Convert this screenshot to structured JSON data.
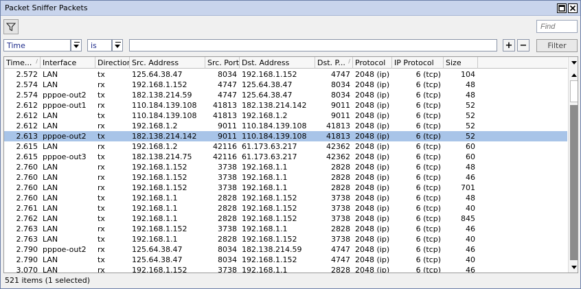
{
  "window": {
    "title": "Packet Sniffer Packets"
  },
  "toolbar": {
    "filter_icon": "funnel-icon",
    "find_placeholder": "Find"
  },
  "filterbar": {
    "field_value": "Time",
    "operator_value": "is",
    "value_text": "",
    "add_label": "+",
    "remove_label": "−",
    "apply_label": "Filter"
  },
  "grid": {
    "columns": [
      {
        "label": "Time...",
        "sort": "/"
      },
      {
        "label": "Interface",
        "sort": ""
      },
      {
        "label": "Direction",
        "sort": ""
      },
      {
        "label": "Src. Address",
        "sort": ""
      },
      {
        "label": "Src. Port",
        "sort": ""
      },
      {
        "label": "Dst. Address",
        "sort": ""
      },
      {
        "label": "Dst. P...",
        "sort": "/"
      },
      {
        "label": "Protocol",
        "sort": ""
      },
      {
        "label": "IP Protocol",
        "sort": ""
      },
      {
        "label": "Size",
        "sort": ""
      }
    ],
    "rows": [
      [
        "2.572",
        "LAN",
        "tx",
        "125.64.38.47",
        "8034",
        "192.168.1.152",
        "4747",
        "2048 (ip)",
        "6 (tcp)",
        "104"
      ],
      [
        "2.574",
        "LAN",
        "rx",
        "192.168.1.152",
        "4747",
        "125.64.38.47",
        "8034",
        "2048 (ip)",
        "6 (tcp)",
        "48"
      ],
      [
        "2.574",
        "pppoe-out2",
        "tx",
        "182.138.214.59",
        "4747",
        "125.64.38.47",
        "8034",
        "2048 (ip)",
        "6 (tcp)",
        "48"
      ],
      [
        "2.612",
        "pppoe-out1",
        "rx",
        "110.184.139.108",
        "41813",
        "182.138.214.142",
        "9011",
        "2048 (ip)",
        "6 (tcp)",
        "52"
      ],
      [
        "2.612",
        "LAN",
        "tx",
        "110.184.139.108",
        "41813",
        "192.168.1.2",
        "9011",
        "2048 (ip)",
        "6 (tcp)",
        "52"
      ],
      [
        "2.612",
        "LAN",
        "rx",
        "192.168.1.2",
        "9011",
        "110.184.139.108",
        "41813",
        "2048 (ip)",
        "6 (tcp)",
        "52"
      ],
      [
        "2.613",
        "pppoe-out2",
        "tx",
        "182.138.214.142",
        "9011",
        "110.184.139.108",
        "41813",
        "2048 (ip)",
        "6 (tcp)",
        "52"
      ],
      [
        "2.615",
        "LAN",
        "rx",
        "192.168.1.2",
        "42116",
        "61.173.63.217",
        "42362",
        "2048 (ip)",
        "6 (tcp)",
        "60"
      ],
      [
        "2.615",
        "pppoe-out3",
        "tx",
        "182.138.214.75",
        "42116",
        "61.173.63.217",
        "42362",
        "2048 (ip)",
        "6 (tcp)",
        "60"
      ],
      [
        "2.760",
        "LAN",
        "rx",
        "192.168.1.152",
        "3738",
        "192.168.1.1",
        "2828",
        "2048 (ip)",
        "6 (tcp)",
        "48"
      ],
      [
        "2.760",
        "LAN",
        "rx",
        "192.168.1.152",
        "3738",
        "192.168.1.1",
        "2828",
        "2048 (ip)",
        "6 (tcp)",
        "46"
      ],
      [
        "2.760",
        "LAN",
        "rx",
        "192.168.1.152",
        "3738",
        "192.168.1.1",
        "2828",
        "2048 (ip)",
        "6 (tcp)",
        "701"
      ],
      [
        "2.760",
        "LAN",
        "tx",
        "192.168.1.1",
        "2828",
        "192.168.1.152",
        "3738",
        "2048 (ip)",
        "6 (tcp)",
        "48"
      ],
      [
        "2.761",
        "LAN",
        "tx",
        "192.168.1.1",
        "2828",
        "192.168.1.152",
        "3738",
        "2048 (ip)",
        "6 (tcp)",
        "40"
      ],
      [
        "2.762",
        "LAN",
        "tx",
        "192.168.1.1",
        "2828",
        "192.168.1.152",
        "3738",
        "2048 (ip)",
        "6 (tcp)",
        "845"
      ],
      [
        "2.763",
        "LAN",
        "rx",
        "192.168.1.152",
        "3738",
        "192.168.1.1",
        "2828",
        "2048 (ip)",
        "6 (tcp)",
        "46"
      ],
      [
        "2.763",
        "LAN",
        "tx",
        "192.168.1.1",
        "2828",
        "192.168.1.152",
        "3738",
        "2048 (ip)",
        "6 (tcp)",
        "40"
      ],
      [
        "2.790",
        "pppoe-out2",
        "rx",
        "125.64.38.47",
        "8034",
        "182.138.214.59",
        "4747",
        "2048 (ip)",
        "6 (tcp)",
        "46"
      ],
      [
        "2.790",
        "LAN",
        "tx",
        "125.64.38.47",
        "8034",
        "192.168.1.152",
        "4747",
        "2048 (ip)",
        "6 (tcp)",
        "40"
      ],
      [
        "3.070",
        "LAN",
        "rx",
        "192.168.1.152",
        "3738",
        "192.168.1.1",
        "2828",
        "2048 (ip)",
        "6 (tcp)",
        "46"
      ]
    ],
    "selected_index": 6
  },
  "status": {
    "text": "521 items (1 selected)"
  },
  "colors": {
    "selection": "#a8c4e8",
    "titlebar": "#c8d4ec"
  }
}
